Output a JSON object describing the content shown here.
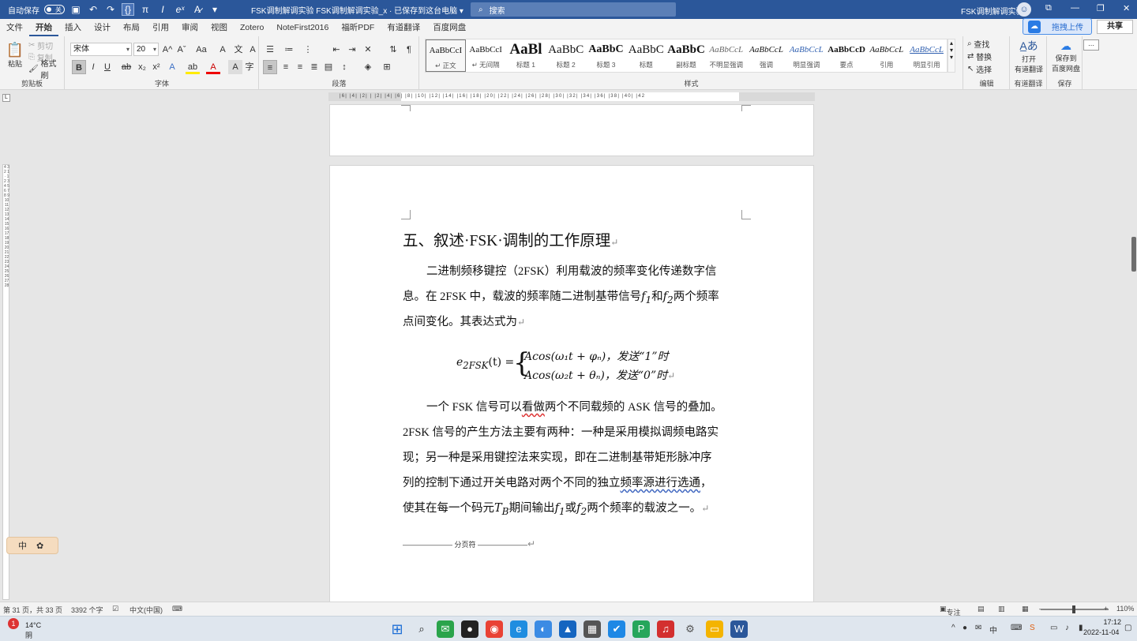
{
  "titlebar": {
    "autosave_label": "自动保存",
    "autosave_state": "关",
    "doc_title": "FSK调制解调实验  FSK调制解调实验_x  · 已保存到这台电脑 ▾",
    "search_placeholder": "搜索",
    "user_name": "FSK调制解调实验",
    "avatar": "☺",
    "minimize": "—",
    "restore": "❐",
    "close": "✕",
    "ribbon_display": "⧉"
  },
  "menu": [
    "文件",
    "开始",
    "插入",
    "设计",
    "布局",
    "引用",
    "审阅",
    "视图",
    "Zotero",
    "NoteFirst2016",
    "福昕PDF",
    "有道翻译",
    "百度网盘"
  ],
  "upload_label": "拖拽上传",
  "share_label": "共享",
  "ribbon": {
    "clipboard": {
      "paste": "粘贴",
      "cut": "剪切",
      "copy": "复制",
      "format_painter": "格式刷",
      "label": "剪贴板"
    },
    "font": {
      "name": "宋体",
      "size": "20",
      "label": "字体",
      "grow": "A^",
      "shrink": "Aˇ",
      "case": "Aa",
      "clear": "A",
      "bold": "B",
      "italic": "I",
      "underline": "U",
      "strike": "ab",
      "sub": "x₂",
      "sup": "x²",
      "effects": "A",
      "highlight": "ab",
      "color": "A",
      "shading": "A",
      "encircle": "字"
    },
    "paragraph": {
      "label": "段落"
    },
    "styles": {
      "label": "样式",
      "items": [
        {
          "preview": "AaBbCcI",
          "name": "↵ 正文"
        },
        {
          "preview": "AaBbCcI",
          "name": "↵ 无间隔"
        },
        {
          "preview": "AaBl",
          "name": "标题 1"
        },
        {
          "preview": "AaBbC",
          "name": "标题 2"
        },
        {
          "preview": "AaBbC",
          "name": "标题 3"
        },
        {
          "preview": "AaBbC",
          "name": "标题"
        },
        {
          "preview": "AaBbC",
          "name": "副标题"
        },
        {
          "preview": "AaBbCcL",
          "name": "不明显强调"
        },
        {
          "preview": "AaBbCcL",
          "name": "强调"
        },
        {
          "preview": "AaBbCcL",
          "name": "明显强调"
        },
        {
          "preview": "AaBbCcD",
          "name": "要点"
        },
        {
          "preview": "AaBbCcL",
          "name": "引用"
        },
        {
          "preview": "AaBbCcL",
          "name": "明显引用"
        }
      ]
    },
    "editing": {
      "find": "查找",
      "replace": "替换",
      "select": "选择",
      "label": "编辑"
    },
    "translate": {
      "btn": "打开\n有道翻译",
      "label": "有道翻译"
    },
    "save": {
      "btn": "保存到\n百度网盘",
      "label": "保存"
    }
  },
  "ruler_ticks": "|6| |4| |2| |   |2| |4| |6| |8| |10| |12| |14| |16| |18| |20| |22| |24| |26| |28| |30| |32| |34| |36| |38| |40| |42",
  "vruler_ticks": "4 3 2 1 · 1 2 3 4 5 6 7 8 9 10 11 12 13 14 15 16 17 18 19 20 21 22 23 24 25 26 27 28",
  "document": {
    "heading": "五、叙述·FSK·调制的工作原理",
    "para1": {
      "line1": "二进制频移键控（2FSK）利用载波的频率变化传递数字信",
      "line2a": "息。在 2FSK 中，载波的频率随二进制基带信号",
      "f1": "f",
      "f1sub": "1",
      "and": "和",
      "f2": "f",
      "f2sub": "2",
      "line2b": "两个频率",
      "line3": "点间变化。其表达式为"
    },
    "equation": {
      "lhs": "e",
      "lhs_sub": "2FSK",
      "lhs_rest": "(t) =",
      "case1": "Acos(ω₁t + φₙ)，发送“1”时",
      "case2": "Acos(ω₂t + θₙ)，发送“0”时"
    },
    "para2": {
      "line1a": "一个 FSK 信号可以",
      "line1b": "看做",
      "line1c": "两个不同载频的 ASK 信号的叠加。",
      "line2": "2FSK 信号的产生方法主要有两种：一种是采用模拟调频电路实",
      "line3": "现；另一种是采用键控法来实现，即在二进制基带矩形脉冲序",
      "line4a": "列的控制下通过开关电路对两个不同的独立",
      "line4b": "频率源进行选通",
      "line4c": "，",
      "line5a": "使其在每一个码元",
      "tb": "T",
      "tbsub": "B",
      "line5b": "期间输出",
      "line5c": "或",
      "line5d": "两个频率的载波之一。"
    },
    "page_break": "——————— 分页符 ———————"
  },
  "status": {
    "page": "第 31 页，共 33 页",
    "words": "3392 个字",
    "lang": "中文(中国)",
    "focus": "专注",
    "zoom": "110%",
    "zoom_minus": "—",
    "zoom_plus": "+"
  },
  "ime": {
    "mode": "中"
  },
  "taskbar": {
    "weather_temp": "14°C",
    "weather_desc": "阴",
    "notif_count": "1",
    "time": "17:12",
    "date": "2022-11-04",
    "tray_lang": "中"
  }
}
